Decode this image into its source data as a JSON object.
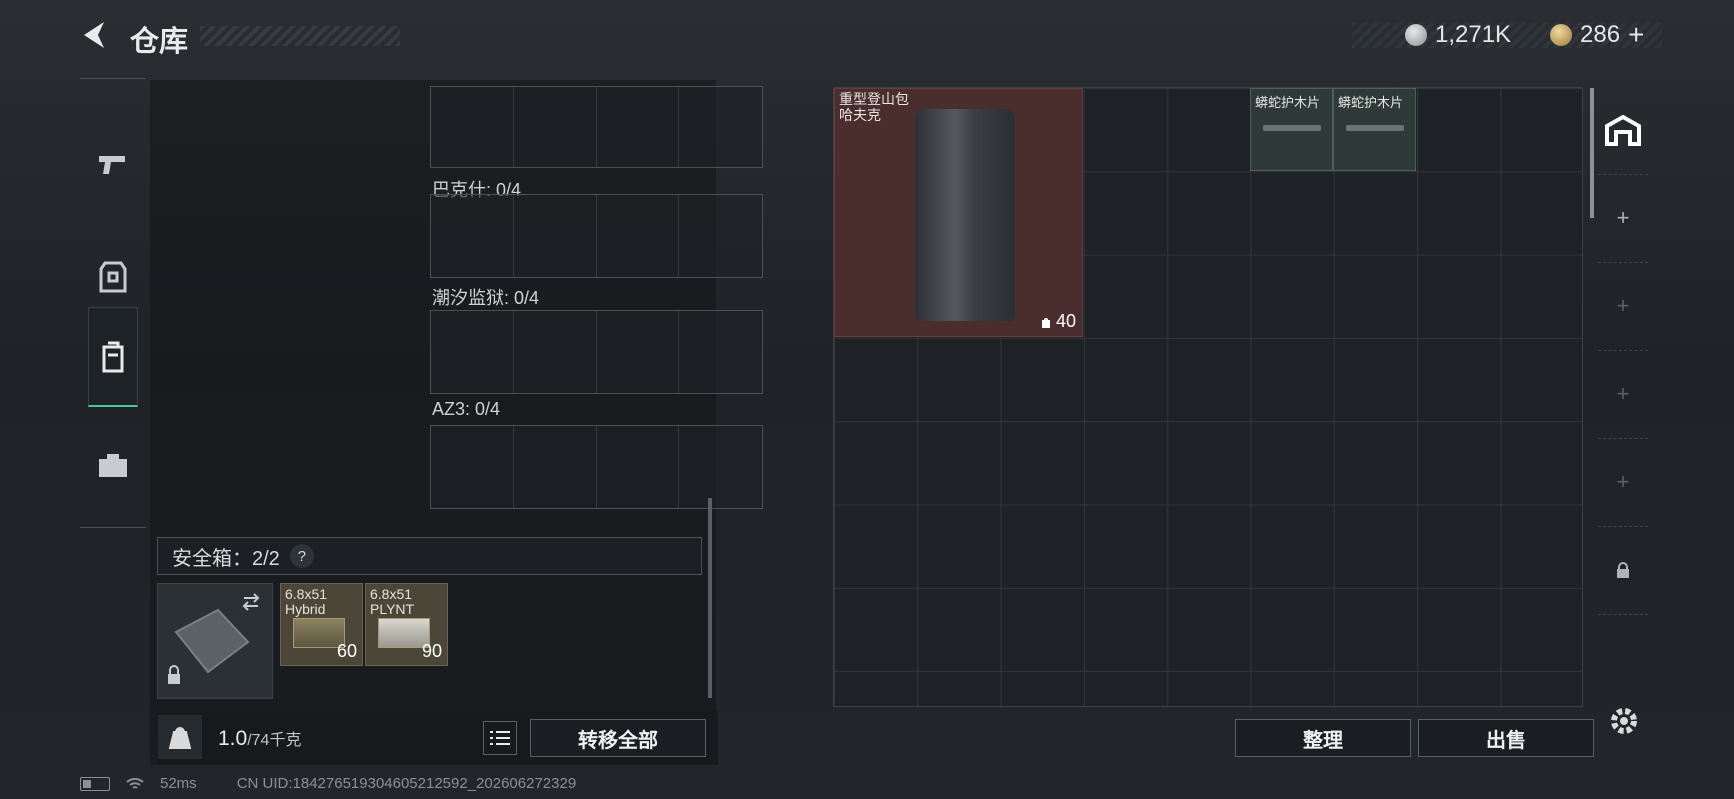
{
  "header": {
    "title": "仓库",
    "currency_silver": "1,271K",
    "currency_gold": "286",
    "add_currency": "+"
  },
  "left_tabs": [
    {
      "icon": "pistol-icon"
    },
    {
      "icon": "armor-icon"
    },
    {
      "icon": "backpack-icon",
      "active": true
    },
    {
      "icon": "toolbox-icon"
    }
  ],
  "attachment_slots": [
    {
      "label": "巴克什: 0/4"
    },
    {
      "label": "潮汐监狱: 0/4"
    },
    {
      "label": "AZ3: 0/4"
    }
  ],
  "safe_box": {
    "label": "安全箱：2/2",
    "help": "?",
    "items": [
      {
        "name": "6.8x51\nHybrid",
        "count": "60"
      },
      {
        "name": "6.8x51\nPLYNT",
        "count": "90"
      }
    ]
  },
  "footer_left": {
    "weight": "1.0",
    "weight_max": "/74千克",
    "transfer_all": "转移全部"
  },
  "stash": {
    "backpack": {
      "name_line1": "重型登山包",
      "name_line2": "哈夫克",
      "capacity": "40"
    },
    "grips": [
      {
        "name": "蟒蛇护木片"
      },
      {
        "name": "蟒蛇护木片"
      }
    ],
    "sort_label": "整理",
    "sell_label": "出售",
    "rail_add": "+"
  },
  "status_bar": {
    "ping": "52ms",
    "uid": "CN UID:184276519304605212592_202606272329"
  },
  "colors": {
    "accent": "#4fc59a",
    "backpack_bg": "#4a2d2d",
    "grip_bg": "#2f3a38",
    "ammo_bg": "#4b4638"
  }
}
